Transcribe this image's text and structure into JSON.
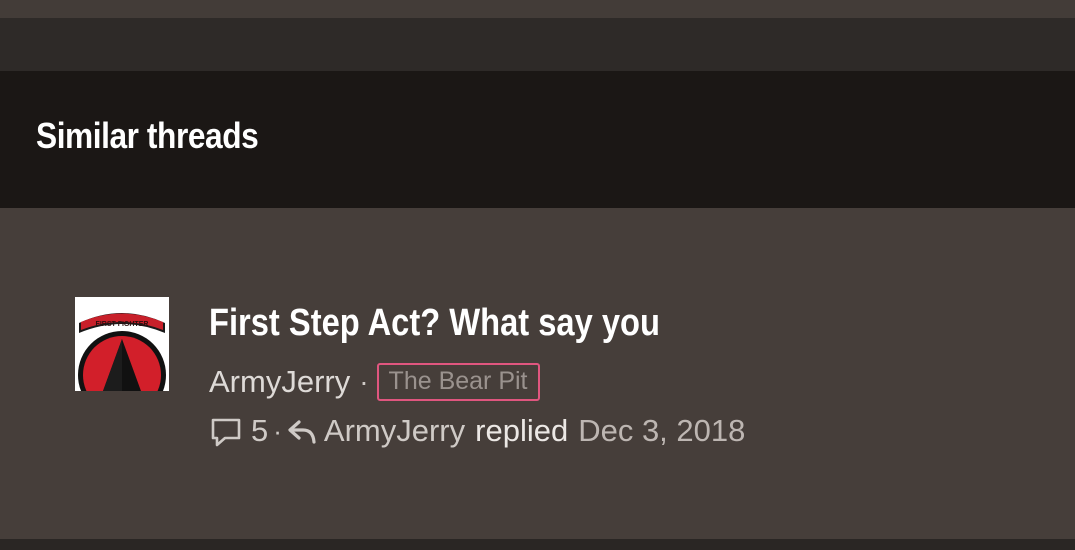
{
  "section": {
    "title": "Similar threads"
  },
  "thread": {
    "title": "First Step Act? What say you",
    "author": "ArmyJerry",
    "forum": "The Bear Pit",
    "reply_count": "5",
    "last_poster": "ArmyJerry",
    "last_action": "replied",
    "last_date": "Dec 3, 2018",
    "avatar_badge_text": "FIRST FIGHTER"
  },
  "colors": {
    "header_bg": "#1b1715",
    "panel_bg": "#463e3a",
    "tag_border": "#e0567f",
    "patch_red": "#d21f2a",
    "patch_black": "#111111"
  },
  "icons": [
    "comment-icon",
    "reply-icon"
  ]
}
